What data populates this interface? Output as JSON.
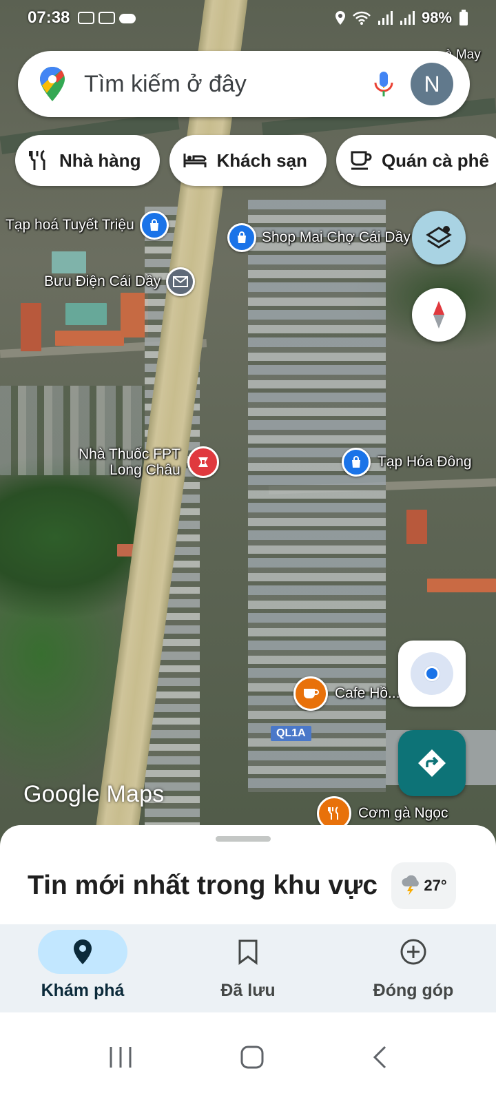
{
  "status_bar": {
    "time": "07:38",
    "battery": "98%"
  },
  "search": {
    "placeholder": "Tìm kiếm ở đây",
    "avatar_letter": "N"
  },
  "chips": [
    {
      "label": "Nhà hàng",
      "icon": "restaurant-icon"
    },
    {
      "label": "Khách sạn",
      "icon": "hotel-icon"
    },
    {
      "label": "Quán cà phê",
      "icon": "cafe-icon"
    }
  ],
  "map": {
    "pois": [
      {
        "label": "Tạp hoá Tuyết Triệu",
        "type": "shopping"
      },
      {
        "label": "Shop Mai Chợ Cái Dầy",
        "type": "shopping"
      },
      {
        "label": "Bưu Điện Cái Dầy",
        "type": "post-office"
      },
      {
        "label": "Nhà Thuốc FPT\nLong Châu",
        "type": "pharmacy"
      },
      {
        "label": "Tạp Hóa Đông",
        "type": "shopping"
      },
      {
        "label": "Cafe Hồ...ong",
        "type": "cafe"
      },
      {
        "label": "Cơm gà Ngọc",
        "type": "restaurant"
      },
      {
        "label": "à May",
        "type": "place"
      }
    ],
    "road_label": "QL1A",
    "watermark": "Google Maps"
  },
  "sheet": {
    "title": "Tin mới nhất trong khu vực",
    "temperature": "27°"
  },
  "bottom_nav": [
    {
      "label": "Khám phá",
      "icon": "explore-pin-icon",
      "active": true
    },
    {
      "label": "Đã lưu",
      "icon": "bookmark-icon",
      "active": false
    },
    {
      "label": "Đóng góp",
      "icon": "add-circle-icon",
      "active": false
    }
  ],
  "colors": {
    "accent": "#1a73e8",
    "directions": "#0d7377",
    "active_nav": "#c2e7ff"
  }
}
